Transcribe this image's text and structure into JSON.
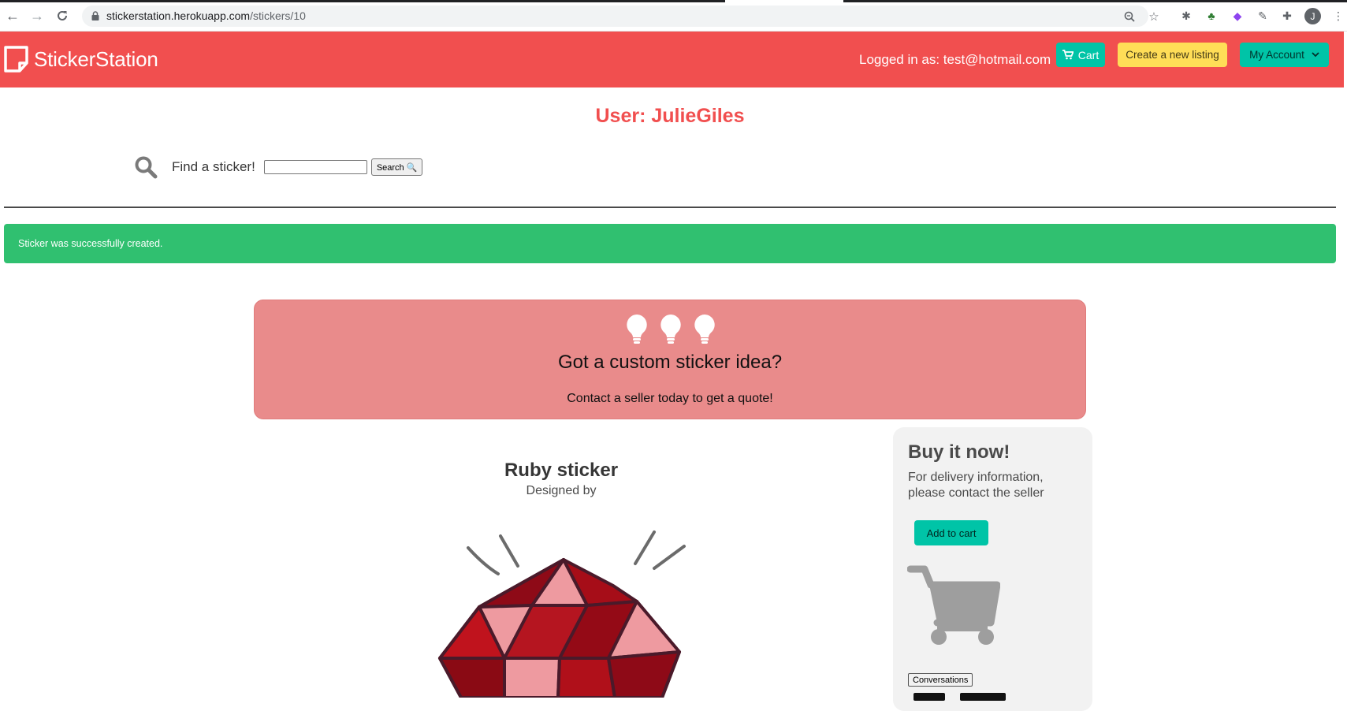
{
  "browser": {
    "url_host": "stickerstation.herokuapp.com",
    "url_path": "/stickers/10",
    "profile_initial": "J"
  },
  "navbar": {
    "brand": "StickerStation",
    "logged_in": "Logged in as: test@hotmail.com",
    "cart_label": "Cart",
    "create_label": "Create a new listing",
    "account_label": "My Account"
  },
  "page": {
    "user_title": "User: JulieGiles",
    "find_label": "Find a sticker!",
    "search_value": "",
    "search_button": "Search 🔍"
  },
  "notice": {
    "text": "Sticker was successfully created."
  },
  "idea": {
    "title": "Got a custom sticker idea?",
    "subtitle": "Contact a seller today to get a quote!"
  },
  "sticker": {
    "title": "Ruby sticker",
    "designed_by": "Designed by"
  },
  "buy": {
    "title": "Buy it now!",
    "subtitle": "For delivery information, please contact the seller",
    "add_to_cart": "Add to cart",
    "conversations": "Conversations"
  },
  "colors": {
    "navbar": "#f14f4f",
    "primary": "#00c4a7",
    "warning": "#ffdd57",
    "success": "#30c070",
    "idea_box": "#e98b8b"
  }
}
